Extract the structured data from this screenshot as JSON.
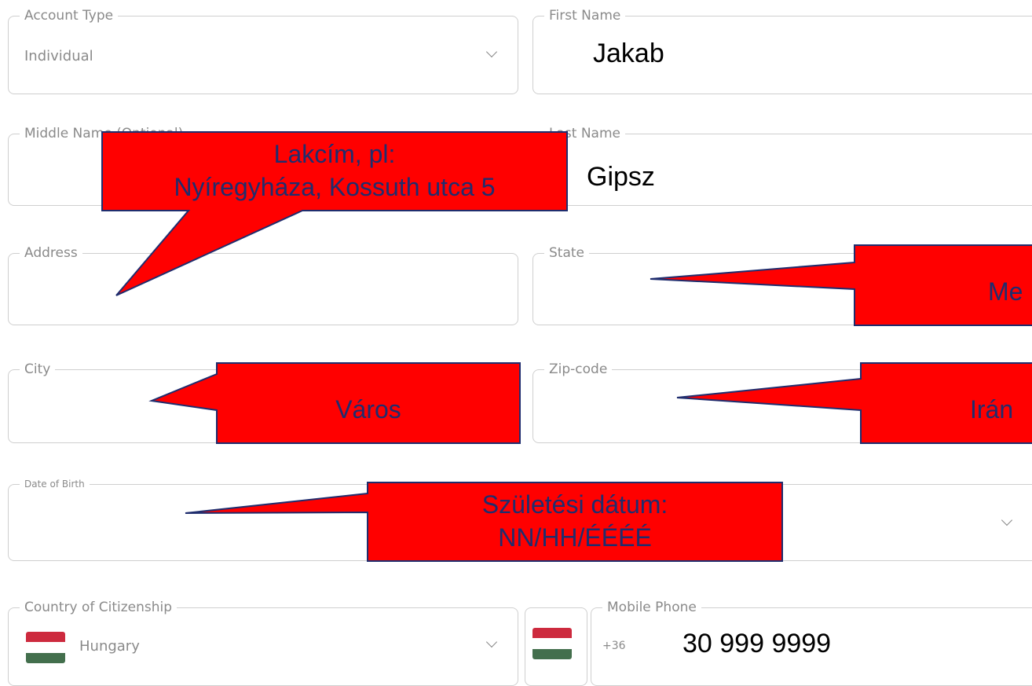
{
  "form": {
    "account_type": {
      "label": "Account Type",
      "value": "Individual"
    },
    "first_name": {
      "label": "First Name",
      "value": "Jakab"
    },
    "middle_name": {
      "label": "Middle Name (Optional)"
    },
    "last_name": {
      "label": "Last Name",
      "value": "Gipsz"
    },
    "address": {
      "label": "Address"
    },
    "state": {
      "label": "State"
    },
    "city": {
      "label": "City"
    },
    "zip": {
      "label": "Zip-code"
    },
    "dob": {
      "label": "Date of Birth"
    },
    "citizenship": {
      "label": "Country of Citizenship",
      "value": "Hungary"
    },
    "mobile": {
      "label": "Mobile Phone",
      "prefix": "+36",
      "value": "30 999 9999"
    }
  },
  "callouts": {
    "address_line1": "Lakcím, pl:",
    "address_line2": "Nyíregyháza, Kossuth utca 5",
    "state": "Me",
    "city": "Város",
    "zip": "Irán",
    "dob_line1": "Születési dátum:",
    "dob_line2": "NN/HH/ÉÉÉÉ"
  },
  "colors": {
    "callout_fill": "#ff0000",
    "callout_text": "#1f2d6e",
    "field_border": "#cfcfcf"
  },
  "icons": [
    "chevron-down-icon",
    "hungary-flag-icon"
  ]
}
